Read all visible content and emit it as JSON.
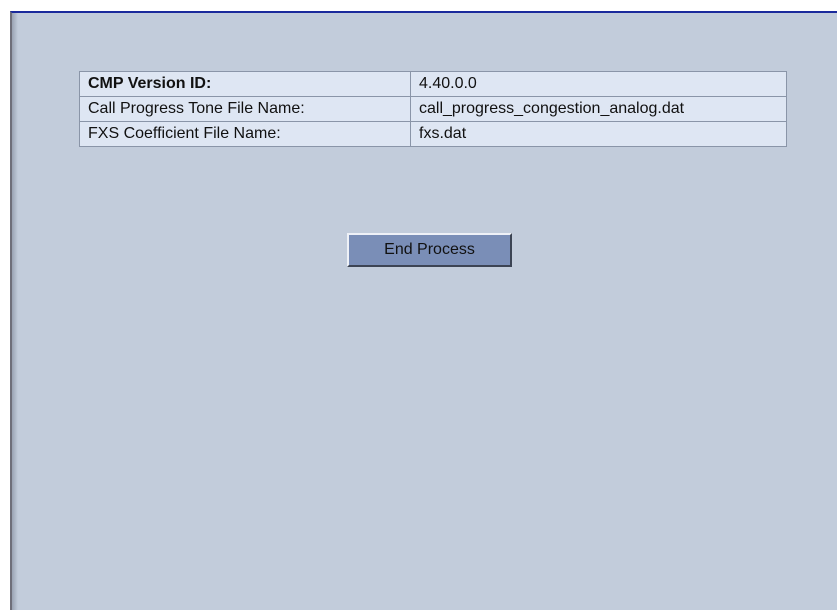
{
  "info_rows": [
    {
      "label": "CMP Version ID:",
      "value": "4.40.0.0"
    },
    {
      "label": "Call Progress Tone File Name:",
      "value": "call_progress_congestion_analog.dat"
    },
    {
      "label": "FXS Coefficient File Name:",
      "value": "fxs.dat"
    }
  ],
  "actions": {
    "end_process_label": "End Process"
  },
  "colors": {
    "panel_background": "#c2ccdb",
    "table_background": "#dee6f3",
    "button_background": "#7a8eb7",
    "top_border": "#1a2a9c"
  }
}
